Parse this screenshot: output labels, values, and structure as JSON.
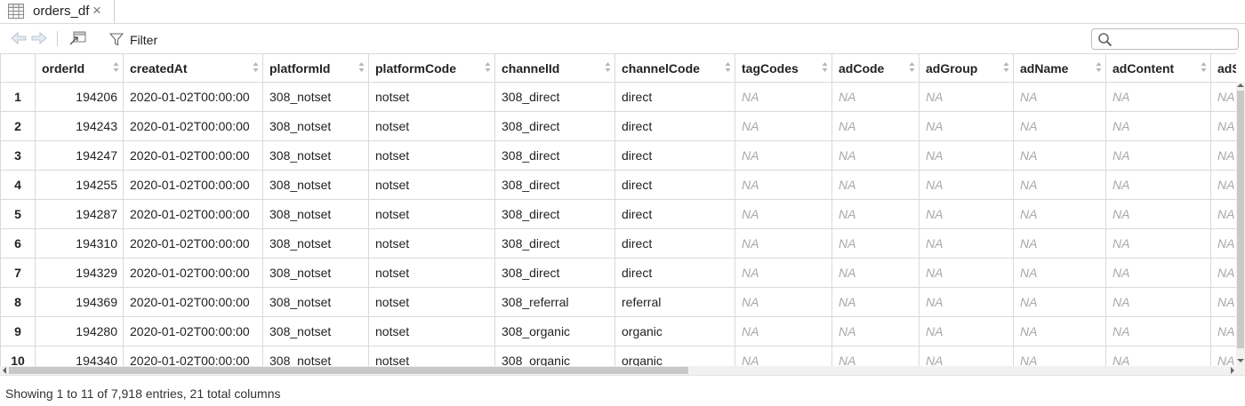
{
  "tab": {
    "label": "orders_df",
    "close": "×"
  },
  "toolbar": {
    "filter_label": "Filter"
  },
  "search": {
    "value": "",
    "placeholder": ""
  },
  "columns": [
    "",
    "orderId",
    "createdAt",
    "platformId",
    "platformCode",
    "channelId",
    "channelCode",
    "tagCodes",
    "adCode",
    "adGroup",
    "adName",
    "adContent",
    "adSe"
  ],
  "rows": [
    [
      "1",
      "194206",
      "2020-01-02T00:00:00",
      "308_notset",
      "notset",
      "308_direct",
      "direct",
      "NA",
      "NA",
      "NA",
      "NA",
      "NA",
      "NA"
    ],
    [
      "2",
      "194243",
      "2020-01-02T00:00:00",
      "308_notset",
      "notset",
      "308_direct",
      "direct",
      "NA",
      "NA",
      "NA",
      "NA",
      "NA",
      "NA"
    ],
    [
      "3",
      "194247",
      "2020-01-02T00:00:00",
      "308_notset",
      "notset",
      "308_direct",
      "direct",
      "NA",
      "NA",
      "NA",
      "NA",
      "NA",
      "NA"
    ],
    [
      "4",
      "194255",
      "2020-01-02T00:00:00",
      "308_notset",
      "notset",
      "308_direct",
      "direct",
      "NA",
      "NA",
      "NA",
      "NA",
      "NA",
      "NA"
    ],
    [
      "5",
      "194287",
      "2020-01-02T00:00:00",
      "308_notset",
      "notset",
      "308_direct",
      "direct",
      "NA",
      "NA",
      "NA",
      "NA",
      "NA",
      "NA"
    ],
    [
      "6",
      "194310",
      "2020-01-02T00:00:00",
      "308_notset",
      "notset",
      "308_direct",
      "direct",
      "NA",
      "NA",
      "NA",
      "NA",
      "NA",
      "NA"
    ],
    [
      "7",
      "194329",
      "2020-01-02T00:00:00",
      "308_notset",
      "notset",
      "308_direct",
      "direct",
      "NA",
      "NA",
      "NA",
      "NA",
      "NA",
      "NA"
    ],
    [
      "8",
      "194369",
      "2020-01-02T00:00:00",
      "308_notset",
      "notset",
      "308_referral",
      "referral",
      "NA",
      "NA",
      "NA",
      "NA",
      "NA",
      "NA"
    ],
    [
      "9",
      "194280",
      "2020-01-02T00:00:00",
      "308_notset",
      "notset",
      "308_organic",
      "organic",
      "NA",
      "NA",
      "NA",
      "NA",
      "NA",
      "NA"
    ],
    [
      "10",
      "194340",
      "2020-01-02T00:00:00",
      "308_notset",
      "notset",
      "308_organic",
      "organic",
      "NA",
      "NA",
      "NA",
      "NA",
      "NA",
      "NA"
    ]
  ],
  "status": {
    "text": "Showing 1 to 11 of 7,918 entries, 21 total columns"
  },
  "icons": {
    "tab": "grid-icon",
    "back": "back-arrow-icon",
    "forward": "forward-arrow-icon",
    "popout": "popout-icon",
    "filter": "funnel-icon",
    "search": "search-icon",
    "sort": "sort-icon"
  }
}
